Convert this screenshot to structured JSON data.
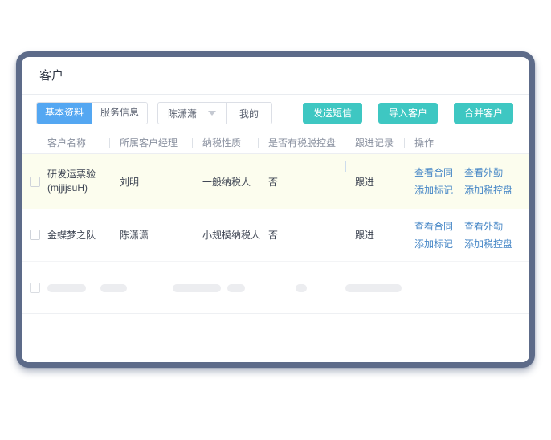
{
  "window": {
    "title": "客户"
  },
  "toolbar": {
    "tabs": [
      {
        "label": "基本资料"
      },
      {
        "label": "服务信息"
      }
    ],
    "manager_select": {
      "value": "陈潇潇"
    },
    "mine_button": "我的",
    "action_buttons": [
      "发送短信",
      "导入客户",
      "合并客户"
    ]
  },
  "table": {
    "headers": [
      "客户名称",
      "所属客户经理",
      "纳税性质",
      "是否有税脱控盘",
      "跟进记录",
      "操作"
    ],
    "rows": [
      {
        "name": "研发运票验",
        "name_suffix": "(mjjijsuH)",
        "manager": "刘明",
        "tax_type": "一般纳税人",
        "has_tax_disk": "否",
        "follow_up": "跟进",
        "links": [
          "查看合同",
          "查看外勤",
          "添加标记",
          "添加税控盘"
        ]
      },
      {
        "name": "金蝶梦之队",
        "name_suffix": "",
        "manager": "陈潇潇",
        "tax_type": "小规模纳税人",
        "has_tax_disk": "否",
        "follow_up": "跟进",
        "links": [
          "查看合同",
          "查看外勤",
          "添加标记",
          "添加税控盘"
        ]
      }
    ]
  },
  "colors": {
    "accent_blue": "#54a7f2",
    "button_teal": "#3ec7c2",
    "link_blue": "#4586c6",
    "highlight_row": "#fcfdee",
    "card_border": "#5d6b89"
  }
}
